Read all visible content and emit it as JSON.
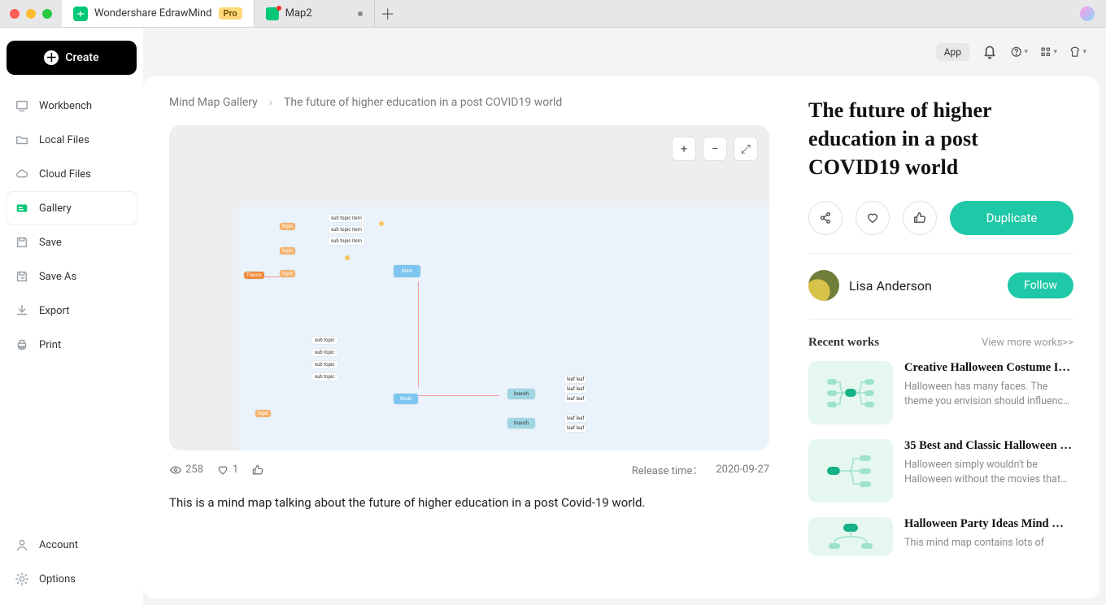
{
  "window": {
    "app_name": "Wondershare EdrawMind",
    "badge": "Pro",
    "tabs": [
      {
        "label": "Wondershare EdrawMind",
        "active": true,
        "badge": "Pro"
      },
      {
        "label": "Map2",
        "active": false,
        "dirty": true
      }
    ]
  },
  "toolbar": {
    "app_chip": "App"
  },
  "sidebar": {
    "create_label": "Create",
    "items": [
      {
        "label": "Workbench"
      },
      {
        "label": "Local Files"
      },
      {
        "label": "Cloud Files"
      },
      {
        "label": "Gallery"
      },
      {
        "label": "Save"
      },
      {
        "label": "Save As"
      },
      {
        "label": "Export"
      },
      {
        "label": "Print"
      }
    ],
    "footer": [
      {
        "label": "Account"
      },
      {
        "label": "Options"
      }
    ],
    "active_index": 3
  },
  "breadcrumb": {
    "root": "Mind Map Gallery",
    "current": "The future of higher education in a post COVID19 world"
  },
  "preview": {
    "tools": {
      "zoom_in": "+",
      "zoom_out": "−",
      "fullscreen": "⤢"
    }
  },
  "stats": {
    "views": "258",
    "likes": "1",
    "release_label": "Release time：",
    "release_date": "2020-09-27"
  },
  "description": "This is a mind map talking about the future of higher education in a post Covid-19 world.",
  "detail": {
    "title": "The future of higher education in a post COVID19 world",
    "actions": {
      "duplicate": "Duplicate"
    },
    "author": {
      "name": "Lisa Anderson",
      "follow": "Follow"
    },
    "recent": {
      "heading": "Recent works",
      "more": "View more works>>",
      "items": [
        {
          "title": "Creative Halloween Costume I…",
          "desc": "Halloween has many faces. The theme you envision should influence how you"
        },
        {
          "title": "35 Best and Classic Halloween …",
          "desc": "Halloween simply wouldn't be Halloween without the movies that go along with it."
        },
        {
          "title": "Halloween Party Ideas Mind …",
          "desc": "This mind map contains lots of"
        }
      ]
    }
  }
}
